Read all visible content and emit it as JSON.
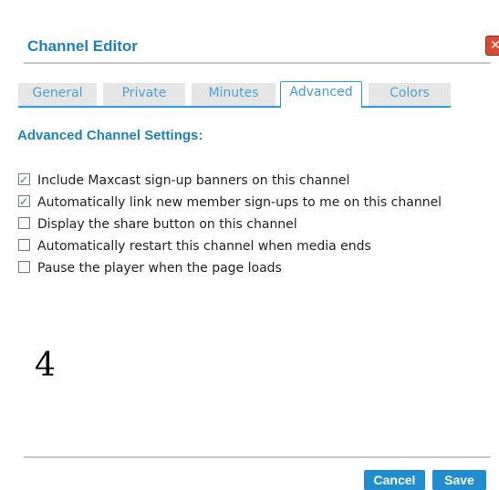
{
  "dialog": {
    "title": "Channel Editor",
    "close_icon": "close-icon"
  },
  "tabs": [
    {
      "label": "General",
      "active": false
    },
    {
      "label": "Private",
      "active": false
    },
    {
      "label": "Minutes",
      "active": false
    },
    {
      "label": "Advanced",
      "active": true
    },
    {
      "label": "Colors",
      "active": false
    }
  ],
  "section": {
    "title": "Advanced Channel Settings:"
  },
  "options": [
    {
      "label": "Include Maxcast sign-up banners on this channel",
      "checked": true
    },
    {
      "label": "Automatically link new member sign-ups to me on this channel",
      "checked": true
    },
    {
      "label": "Display the share button on this channel",
      "checked": false
    },
    {
      "label": "Automatically restart this channel when media ends",
      "checked": false
    },
    {
      "label": "Pause the player when the page loads",
      "checked": false
    }
  ],
  "overlay_number": "4",
  "footer": {
    "cancel_label": "Cancel",
    "save_label": "Save"
  },
  "colors": {
    "accent": "#1a82c2",
    "button": "#1f8dd0",
    "close": "#d84a3a"
  }
}
